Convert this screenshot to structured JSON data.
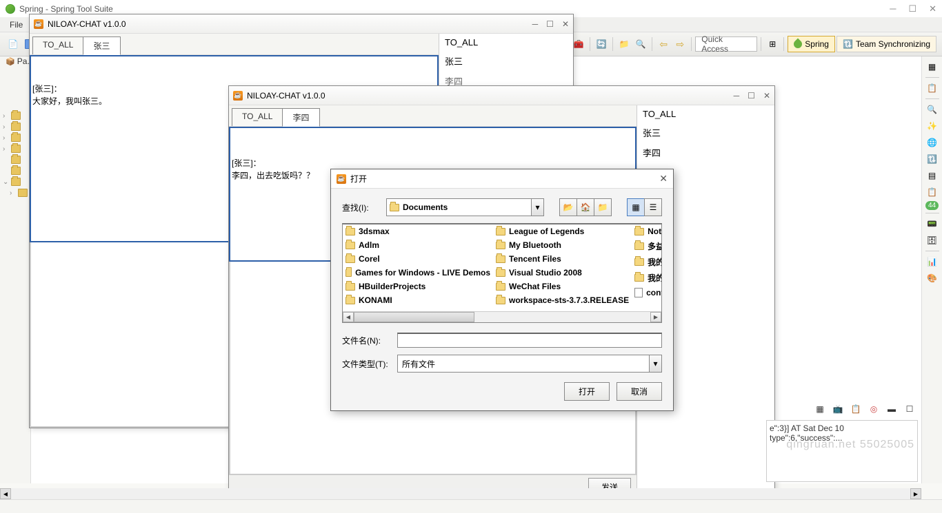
{
  "eclipse": {
    "title": "Spring - Spring Tool Suite",
    "menu_file": "File",
    "quick_access": "Quick Access",
    "perspective_spring": "Spring",
    "perspective_team": "Team Synchronizing",
    "left_panel_label": "Pa..."
  },
  "chat_a": {
    "title": "NILOAY-CHAT v1.0.0",
    "tab_all": "TO_ALL",
    "tab_other": "张三",
    "log_line1": "[张三]：",
    "log_line2": "大家好，我叫张三。",
    "ul_all": "TO_ALL",
    "ul_user1": "张三",
    "ul_user2": "李四"
  },
  "chat_b": {
    "title": "NILOAY-CHAT v1.0.0",
    "tab_all": "TO_ALL",
    "tab_other": "李四",
    "log_line1": "[张三]：",
    "log_line2": "李四，出去吃饭吗？？",
    "ul_all": "TO_ALL",
    "ul_user1": "张三",
    "ul_user2": "李四",
    "send_label": "发送"
  },
  "file_dialog": {
    "title": "打开",
    "lookin_label": "查找(I):",
    "lookin_value": "Documents",
    "filename_label": "文件名(N):",
    "filename_value": "",
    "filetype_label": "文件类型(T):",
    "filetype_value": "所有文件",
    "open_btn": "打开",
    "cancel_btn": "取消",
    "col1": [
      "3dsmax",
      "Adlm",
      "Corel",
      "Games for Windows - LIVE Demos",
      "HBuilderProjects",
      "KONAMI"
    ],
    "col2": [
      "League of Legends",
      "My Bluetooth",
      "Tencent Files",
      "Visual Studio 2008",
      "WeChat Files",
      "workspace-sts-3.7.3.RELEASE"
    ],
    "col3": [
      "Note",
      "多益",
      "我的",
      "我的",
      "conf"
    ]
  },
  "console": {
    "line1": "e\":3}] AT Sat Dec 10",
    "line2": "type\":6,\"success\":..."
  },
  "watermark": "qingruan.net 55025005",
  "badge": "44"
}
